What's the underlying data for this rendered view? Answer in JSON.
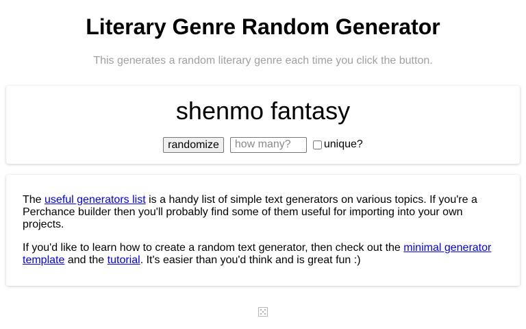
{
  "header": {
    "title": "Literary Genre Random Generator",
    "subtitle": "This generates a random literary genre each time you click the button."
  },
  "generator": {
    "output": "shenmo fantasy",
    "randomize_label": "randomize",
    "count_placeholder": "how many?",
    "count_value": "",
    "unique_label": "unique?",
    "unique_checked": false
  },
  "info": {
    "p1_prefix": "The ",
    "p1_link": "useful generators list",
    "p1_suffix": " is a handy list of simple text generators on various topics. If you're a Perchance builder then you'll probably find some of them useful for importing into your own projects.",
    "p2_prefix": "If you'd like to learn how to create a random text generator, then check out the ",
    "p2_link1": "minimal generator template",
    "p2_middle": " and the ",
    "p2_link2": "tutorial",
    "p2_suffix": ". It's easier than you'd think and is great fun :)"
  },
  "footer": {
    "icon": "dice-icon"
  },
  "colors": {
    "subtitle": "#a0a0a0",
    "link": "#0000ee",
    "background": "#ffffff"
  }
}
